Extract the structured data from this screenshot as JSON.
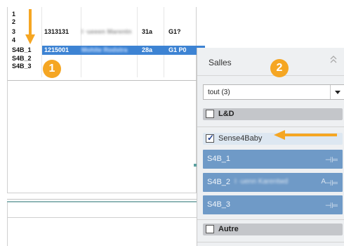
{
  "sheet": {
    "rows": [
      {
        "id": "1",
        "num": "",
        "name": "",
        "age": "",
        "group": ""
      },
      {
        "id": "2",
        "num": "",
        "name": "",
        "age": "",
        "group": ""
      },
      {
        "id": "3",
        "num": "1313131",
        "name": "I ·ueeen Marentn",
        "age": "31a",
        "group": "G1?"
      },
      {
        "id": "4",
        "num": "",
        "name": "",
        "age": "",
        "group": ""
      },
      {
        "id": "S4B_1",
        "num": "1215001",
        "name": "Mohite Rodstra",
        "age": "28a",
        "group": "G1 P0"
      },
      {
        "id": "S4B_2",
        "num": "",
        "name": "",
        "age": "",
        "group": ""
      },
      {
        "id": "S4B_3",
        "num": "",
        "name": "",
        "age": "",
        "group": ""
      }
    ]
  },
  "panel": {
    "title": "Salles",
    "filter_value": "tout (3)",
    "groups": [
      {
        "label": "L&D",
        "checked": false
      },
      {
        "label": "Sense4Baby",
        "checked": true
      },
      {
        "label": "Autre",
        "checked": false
      }
    ],
    "rooms": [
      {
        "label": "S4B_1",
        "extra": ""
      },
      {
        "label": "S4B_2",
        "extra": "I ·uenn Karentwd"
      },
      {
        "label": "S4B_3",
        "extra": ""
      }
    ],
    "pin_icon": "pin-icon",
    "collapse_icon": "double-chevron-up-icon"
  },
  "annotations": {
    "badge1": "1",
    "badge2": "2",
    "accent_color": "#f5a623"
  },
  "colors": {
    "selection": "#3d83d3",
    "room_bg": "#6f9ac7",
    "group_bg": "#c4c6ca"
  }
}
